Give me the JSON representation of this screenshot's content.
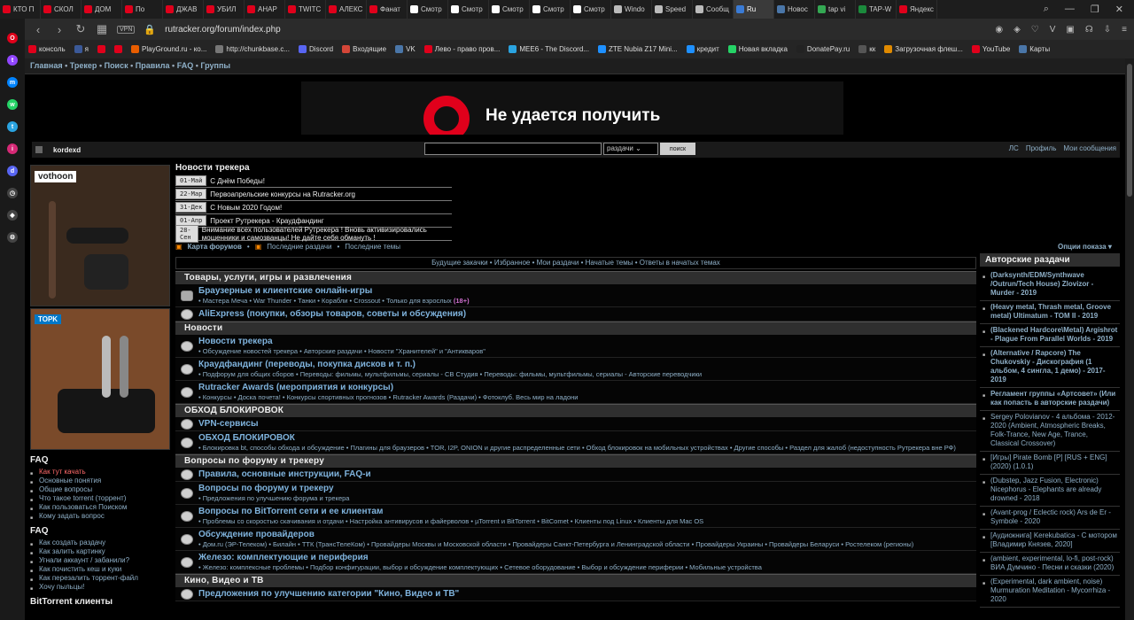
{
  "browser": {
    "tabs": [
      {
        "label": "КТО П",
        "color": "#e0001b"
      },
      {
        "label": "СКОЛ",
        "color": "#e0001b"
      },
      {
        "label": "ДОМ",
        "color": "#e0001b"
      },
      {
        "label": "По",
        "color": "#e0001b"
      },
      {
        "label": "ДЖАВ",
        "color": "#e0001b"
      },
      {
        "label": "УБИЛ",
        "color": "#e0001b"
      },
      {
        "label": "АНАР",
        "color": "#e0001b"
      },
      {
        "label": "TWITC",
        "color": "#e0001b"
      },
      {
        "label": "АЛЕКС",
        "color": "#e0001b"
      },
      {
        "label": "Фанат",
        "color": "#e0001b"
      },
      {
        "label": "Смотр",
        "color": "#ffffff"
      },
      {
        "label": "Смотр",
        "color": "#ffffff"
      },
      {
        "label": "Смотр",
        "color": "#ffffff"
      },
      {
        "label": "Смотр",
        "color": "#ffffff"
      },
      {
        "label": "Смотр",
        "color": "#ffffff"
      },
      {
        "label": "Windo",
        "color": "#bbbbbb"
      },
      {
        "label": "Speed",
        "color": "#bbbbbb"
      },
      {
        "label": "Сообщ",
        "color": "#bbbbbb"
      },
      {
        "label": "Ru",
        "color": "#3a7bd5",
        "active": true
      },
      {
        "label": "Новос",
        "color": "#4a76a8"
      },
      {
        "label": "tap vi",
        "color": "#34a853"
      },
      {
        "label": "TAP-W",
        "color": "#1b8a3c"
      },
      {
        "label": "Яндекс",
        "color": "#e0001b"
      }
    ],
    "url": "rutracker.org/forum/index.php",
    "vpn": "VPN",
    "bookmarks": [
      "консоль",
      "я",
      "",
      "",
      "PlayGround.ru - ко...",
      "http://chunkbase.c...",
      "Discord",
      "Входящие",
      "VK",
      "Лево - право пров...",
      "MEE6 - The Discord...",
      "ZTE Nubia Z17 Mini...",
      "кредит",
      "Новая вкладка",
      "DonatePay.ru",
      "кк",
      "Загрузочная флеш...",
      "YouTube",
      "Карты"
    ]
  },
  "site": {
    "topnav": [
      "Главная",
      "Трекер",
      "Поиск",
      "Правила",
      "FAQ",
      "Группы"
    ],
    "banner_text": "Не удается получить",
    "username": "kordexd",
    "search_select": "раздачи",
    "search_button": "поиск",
    "user_links": [
      "ЛС",
      "Профиль",
      "Мои сообщения"
    ],
    "ad1_brand": "vothoon",
    "ad2_brand": "TOPK",
    "faq1_title": "FAQ",
    "faq1": [
      "Как тут качать",
      "Основные понятия",
      "Общие вопросы",
      "Что такое torrent (торрент)",
      "Как пользоваться Поиском",
      "Кому задать вопрос"
    ],
    "faq2_title": "FAQ",
    "faq2": [
      "Как создать раздачу",
      "Как залить картинку",
      "Угнали аккаунт / забанили?",
      "Как почистить кеш и куки",
      "Как перезалить торрент-файл",
      "Хочу пыльцы!"
    ],
    "bt_title": "BitTorrent клиенты",
    "news_title": "Новости трекера",
    "news": [
      {
        "date": "01-Май",
        "text": "С Днём Победы!"
      },
      {
        "date": "22-Мар",
        "text": "Первоапрельские конкурсы на Rutracker.org"
      },
      {
        "date": "31-Дек",
        "text": "С Новым 2020 Годом!"
      },
      {
        "date": "01-Апр",
        "text": "Проект Рутрекера - Краудфандинг"
      },
      {
        "date": "28-Сен",
        "text": "Внимание всех пользователей Рутрекера ! Вновь активизировались мошенники и самозванцы! Не дайте себя обмануть !"
      }
    ],
    "rss": {
      "map": "Карта форумов",
      "latest": "Последние раздачи",
      "topics": "Последние темы"
    },
    "options": "Опции показа",
    "quick_links": "Будущие закачки • Избранное • Мои раздачи • Начатые темы • Ответы в начатых темах",
    "sections": [
      {
        "title": "Товары, услуги, игры и развлечения",
        "forums": [
          {
            "title": "Браузерные и клиентские онлайн-игры",
            "sub": "• Мастера Меча • War Thunder • Танки • Корабли • Crossout • Только для взрослых",
            "age": "(18+)"
          },
          {
            "title": "AliExpress (покупки, обзоры товаров, советы и обсуждения)",
            "sub": ""
          }
        ]
      },
      {
        "title": "Новости",
        "forums": [
          {
            "title": "Новости трекера",
            "sub": "• Обсуждение новостей трекера • Авторские раздачи • Новости \"Хранителей\" и \"Антикваров\""
          },
          {
            "title": "Краудфандинг (переводы, покупка дисков и т. п.)",
            "sub": "• Подфорум для общих сборов • Переводы: фильмы, мультфильмы, сериалы - СВ Студия • Переводы: фильмы, мультфильмы, сериалы - Авторские переводчики"
          },
          {
            "title": "Rutracker Awards (мероприятия и конкурсы)",
            "sub": "• Конкурсы • Доска почета! • Конкурсы спортивных прогнозов • Rutracker Awards (Раздачи) • Фотоклуб. Весь мир на ладони"
          }
        ]
      },
      {
        "title": "ОБХОД БЛОКИРОВОК",
        "forums": [
          {
            "title": "VPN-сервисы",
            "sub": ""
          },
          {
            "title": "ОБХОД БЛОКИРОВОК",
            "sub": "• Блокировка bt, способы обхода и обсуждение • Плагины для браузеров • TOR, I2P, ONION и другие распределенные сети • Обход блокировок на мобильных устройствах • Другие способы • Раздел для жалоб (недоступность Рутрекера вне РФ)"
          }
        ]
      },
      {
        "title": "Вопросы по форуму и трекеру",
        "forums": [
          {
            "title": "Правила, основные инструкции, FAQ-и",
            "sub": ""
          },
          {
            "title": "Вопросы по форуму и трекеру",
            "sub": "• Предложения по улучшению форума и трекера"
          },
          {
            "title": "Вопросы по BitTorrent сети и ее клиентам",
            "sub": "• Проблемы со скоростью скачивания и отдачи • Настройка антивирусов и файерволов • µTorrent и BitTorrent • BitComet • Клиенты под Linux • Клиенты для Mac OS"
          },
          {
            "title": "Обсуждение провайдеров",
            "sub": "• Дом.ru (ЭР-Телеком) • Билайн • ТТК (ТрансТелеКом) • Провайдеры Москвы и Московской области • Провайдеры Санкт-Петербурга и Ленинградской области • Провайдеры Украины • Провайдеры Беларуси • Ростелеком (регионы)"
          },
          {
            "title": "Железо: комплектующие и периферия",
            "sub": "• Железо: комплексные проблемы • Подбор конфигурации, выбор и обсуждение комплектующих • Сетевое оборудование • Выбор и обсуждение периферии • Мобильные устройства"
          }
        ]
      },
      {
        "title": "Кино, Видео и ТВ",
        "forums": [
          {
            "title": "Предложения по улучшению категории \"Кино, Видео и ТВ\"",
            "sub": ""
          }
        ]
      }
    ],
    "right_title": "Авторские раздачи",
    "right_items": [
      {
        "text": "(Darksynth/EDM/Synthwave /Outrun/Tech House) Zlovizor - Murder - 2019",
        "bold": true
      },
      {
        "text": "(Heavy metal, Thrash metal, Groove metal) Ultimatum - TOM II - 2019",
        "bold": true
      },
      {
        "text": "(Blackened Hardcore\\Metal) Argishrot - Plague From Parallel Worlds - 2019",
        "bold": true
      },
      {
        "text": "(Alternative / Rapcore) The Chukovskiy - Дискография (1 альбом, 4 сингла, 1 демо) - 2017-2019",
        "bold": true
      },
      {
        "text": "Регламент группы «Артсовет» (Или как попасть в авторские раздачи)",
        "bold": true
      },
      {
        "text": "Sergey Polovianov - 4 альбома - 2012-2020 (Ambient, Atmospheric Breaks, Folk-Trance, New Age, Trance, Classical Crossover)",
        "bold": false
      },
      {
        "text": "[Игры] Pirate Bomb [P] [RUS + ENG] (2020) (1.0.1)",
        "bold": false
      },
      {
        "text": "(Dubstep, Jazz Fusion, Electronic) Nicephorus - Elephants are already drowned - 2018",
        "bold": false
      },
      {
        "text": "(Avant-prog / Eclectic rock) Ars de Er - Symbole - 2020",
        "bold": false
      },
      {
        "text": "[Аудиокнига] Kerekubatica - С мотором [Владимир Князев, 2020]",
        "bold": false
      },
      {
        "text": "(ambient, experimental, lo-fi, post-rock) ВИА Думчино - Песни и сказки (2020)",
        "bold": false
      },
      {
        "text": "(Experimental, dark ambient, noise) Murmuration Meditation - Mycorrhiza - 2020",
        "bold": false
      }
    ]
  }
}
